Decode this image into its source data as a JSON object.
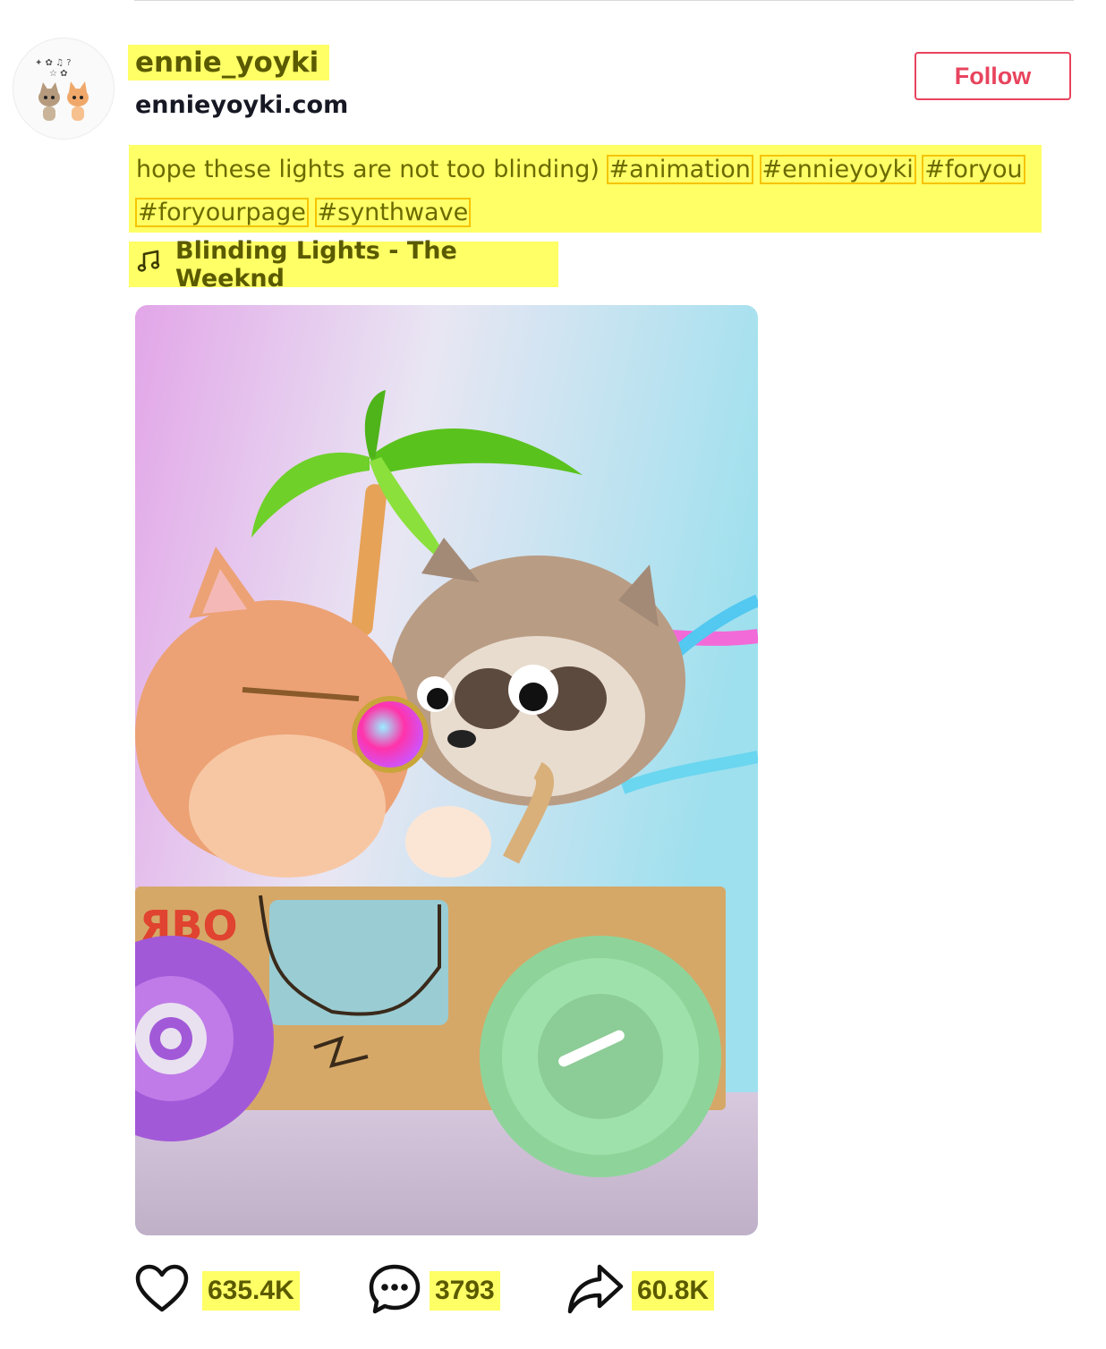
{
  "author": {
    "username": "ennie_yoyki",
    "website": "ennieyoyki.com",
    "follow_label": "Follow"
  },
  "post": {
    "caption_text": "hope these lights are not too blinding)",
    "hashtags": [
      "#animation",
      "#ennieyoyki",
      "#foryou",
      "#foryourpage",
      "#synthwave"
    ],
    "music": "Blinding Lights - The Weeknd"
  },
  "stats": {
    "likes": "635.4K",
    "comments": "3793",
    "shares": "60.8K"
  },
  "icons": {
    "music": "music-note-icon",
    "like": "heart-icon",
    "comment": "comment-bubble-icon",
    "share": "share-arrow-icon"
  },
  "colors": {
    "accent": "#e8445e",
    "highlight": "#ffff66",
    "highlight_border": "#f5c400"
  }
}
